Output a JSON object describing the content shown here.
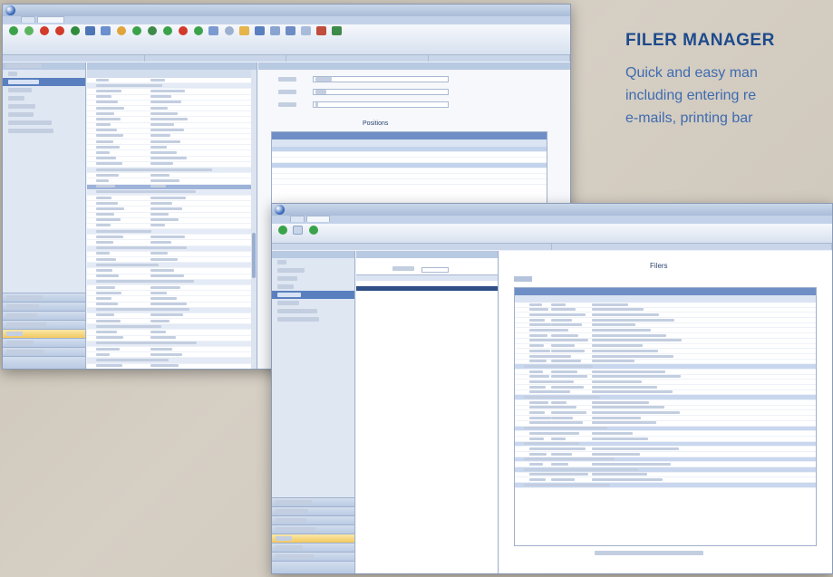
{
  "promo": {
    "title": "FILER MANAGER",
    "line1": "Quick and easy man",
    "line2": "including entering re",
    "line3": "e-mails, printing bar"
  },
  "window1": {
    "nav_items": [
      "",
      "",
      "",
      "",
      "",
      "",
      "",
      ""
    ],
    "positions_title": "Positions"
  },
  "window2": {
    "filers_title": "Filers"
  },
  "colors": {
    "accent": "#1d4b8c",
    "promo_text": "#3d6bb0",
    "selection": "#5a7fbf",
    "highlight": "#f2c95f"
  }
}
